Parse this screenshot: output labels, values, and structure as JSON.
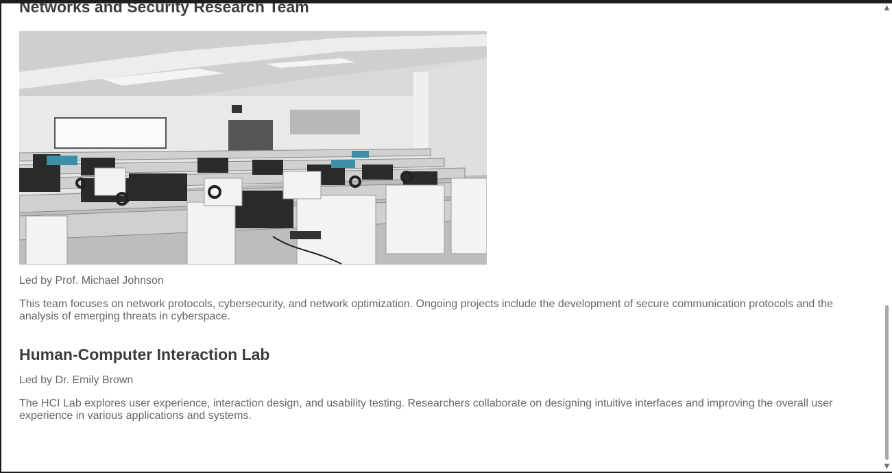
{
  "sections": [
    {
      "title": "Networks and Security Research Team",
      "image_alt": "Computer lab with rows of workstations and headphones",
      "leader": "Led by Prof. Michael Johnson",
      "description": "This team focuses on network protocols, cybersecurity, and network optimization. Ongoing projects include the development of secure communication protocols and the analysis of emerging threats in cyberspace."
    },
    {
      "title": "Human-Computer Interaction Lab",
      "leader": "Led by Dr. Emily Brown",
      "description": "The HCI Lab explores user experience, interaction design, and usability testing. Researchers collaborate on designing intuitive interfaces and improving the overall user experience in various applications and systems."
    }
  ],
  "scrollbar": {
    "up_icon": "chevron-up-icon",
    "down_icon": "chevron-down-icon"
  }
}
